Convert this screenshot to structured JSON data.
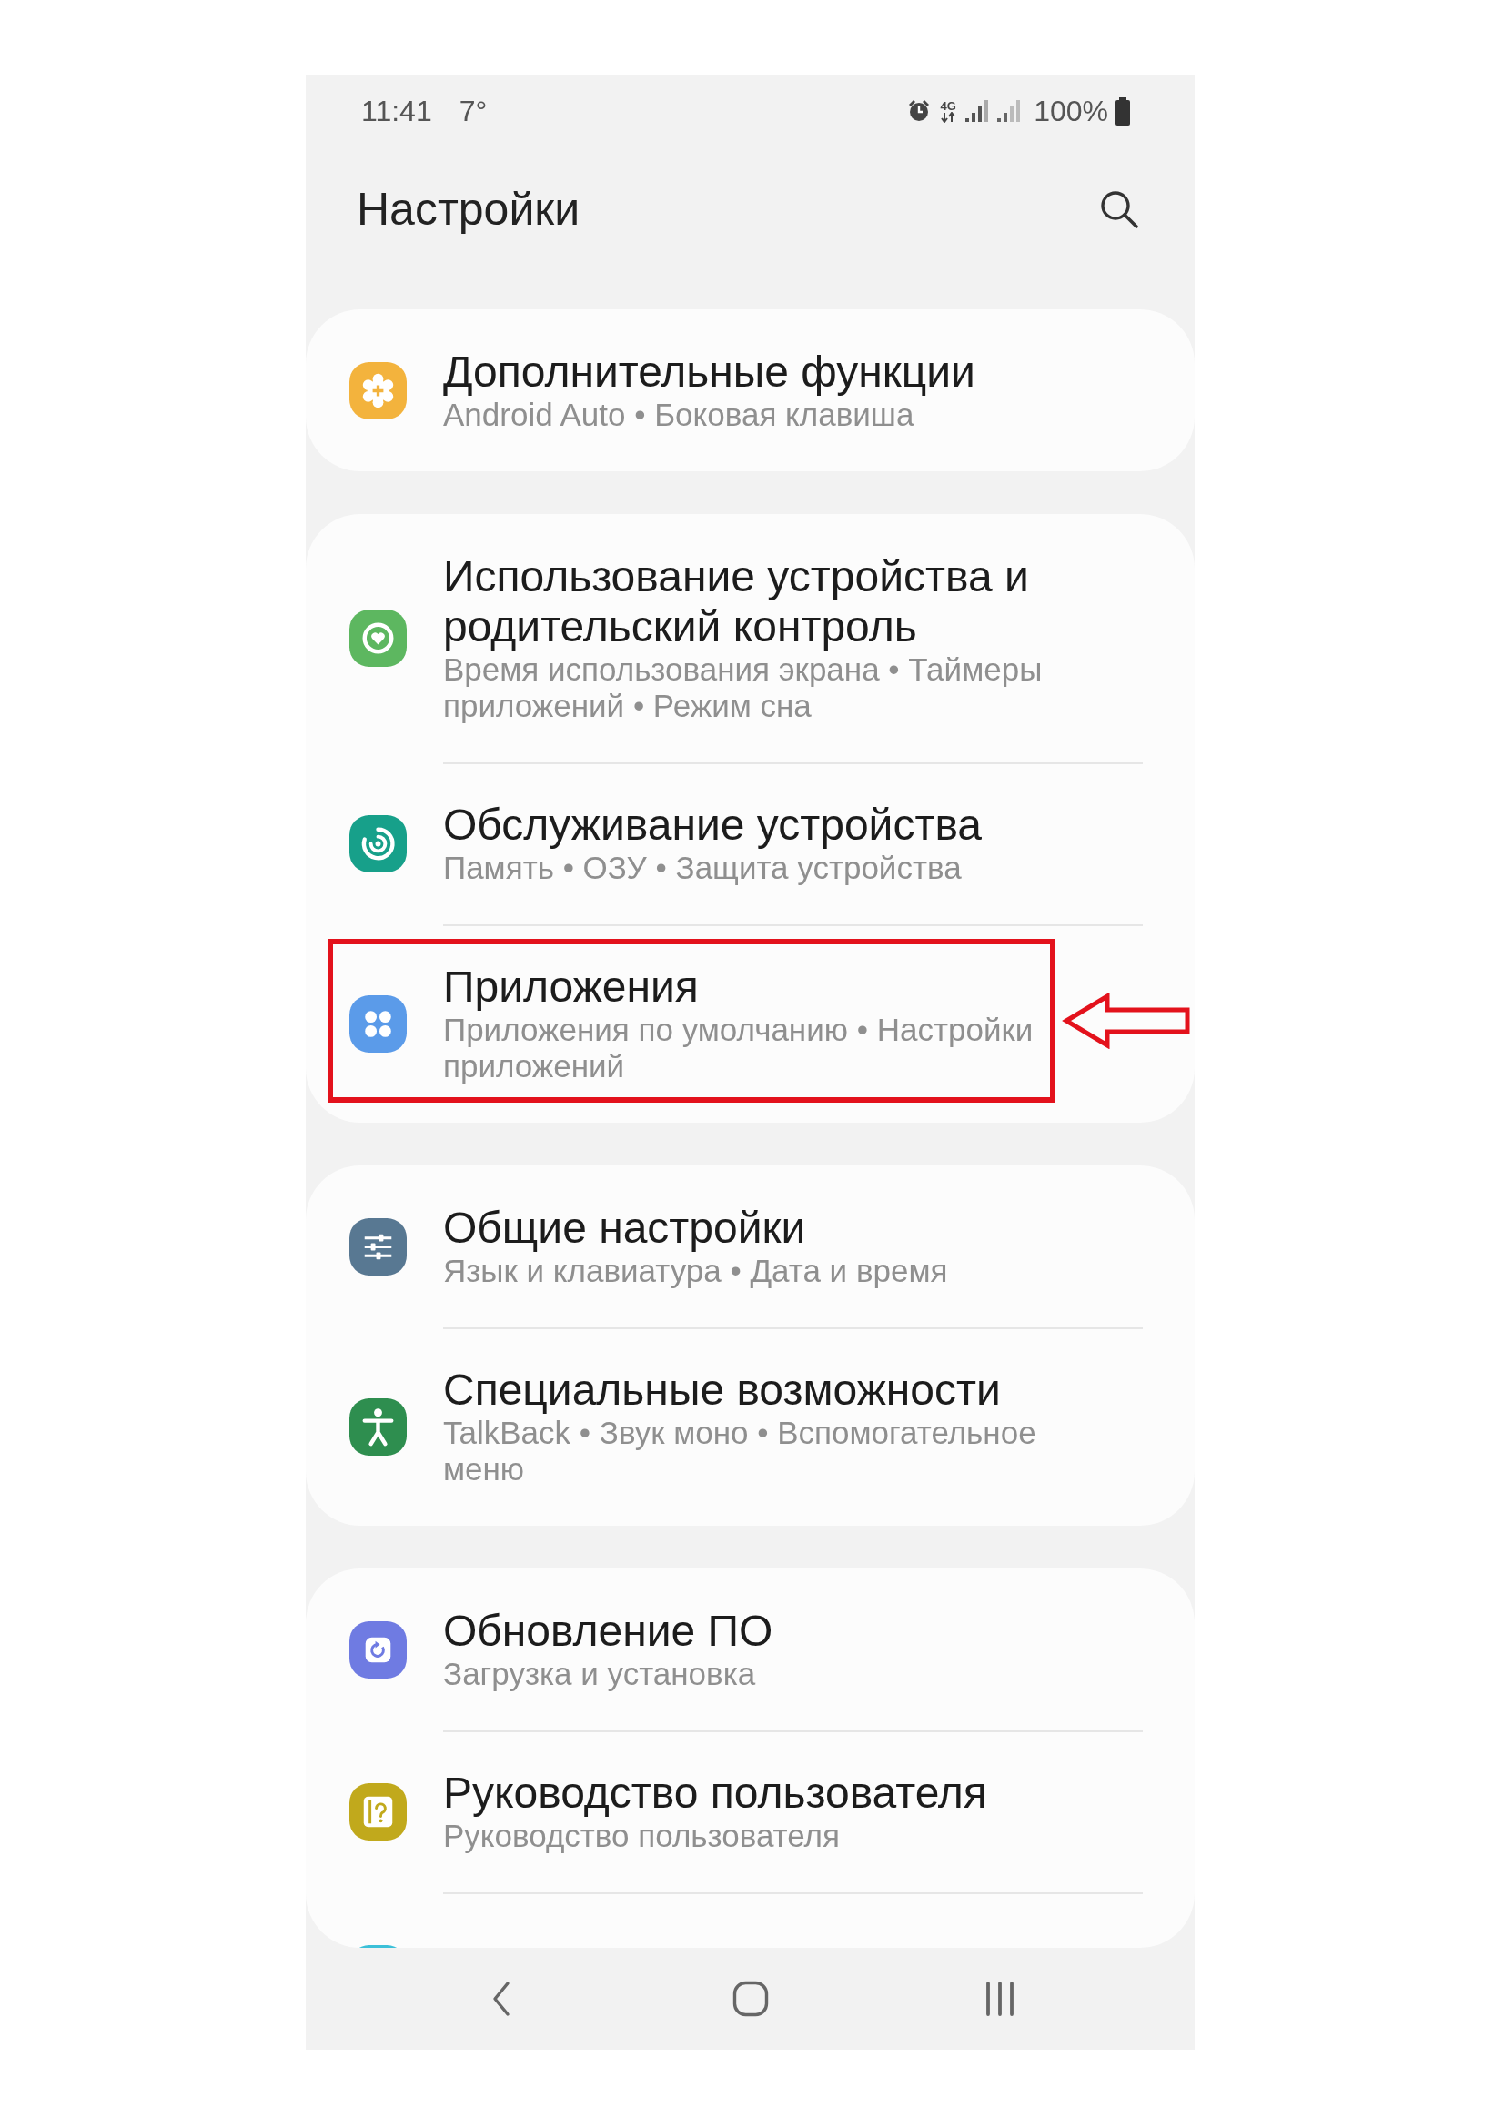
{
  "status_bar": {
    "time": "11:41",
    "temperature": "7°",
    "network": "4G",
    "battery": "100%"
  },
  "header": {
    "title": "Настройки"
  },
  "groups": [
    {
      "items": [
        {
          "title": "Дополнительные функции",
          "subtitle": "Android Auto • Боковая клавиша",
          "color": "#f3b33d",
          "highlighted": false
        }
      ]
    },
    {
      "items": [
        {
          "title": "Использование устройства и родительский контроль",
          "subtitle": "Время использования экрана • Таймеры приложений • Режим сна",
          "color": "#5db760",
          "highlighted": false
        },
        {
          "title": "Обслуживание устройства",
          "subtitle": "Память • ОЗУ • Защита устройства",
          "color": "#17a08a",
          "highlighted": false
        },
        {
          "title": "Приложения",
          "subtitle": "Приложения по умолчанию • Настройки приложений",
          "color": "#5b9be9",
          "highlighted": true
        }
      ]
    },
    {
      "items": [
        {
          "title": "Общие настройки",
          "subtitle": "Язык и клавиатура • Дата и время",
          "color": "#587892",
          "highlighted": false
        },
        {
          "title": "Специальные возможности",
          "subtitle": "TalkBack • Звук моно • Вспомогательное меню",
          "color": "#2e8e4f",
          "highlighted": false
        }
      ]
    },
    {
      "items": [
        {
          "title": "Обновление ПО",
          "subtitle": "Загрузка и установка",
          "color": "#6f7be2",
          "highlighted": false
        },
        {
          "title": "Руководство пользователя",
          "subtitle": "Руководство пользователя",
          "color": "#c1a91c",
          "highlighted": false
        },
        {
          "color": "#3cc0d8"
        }
      ]
    }
  ]
}
